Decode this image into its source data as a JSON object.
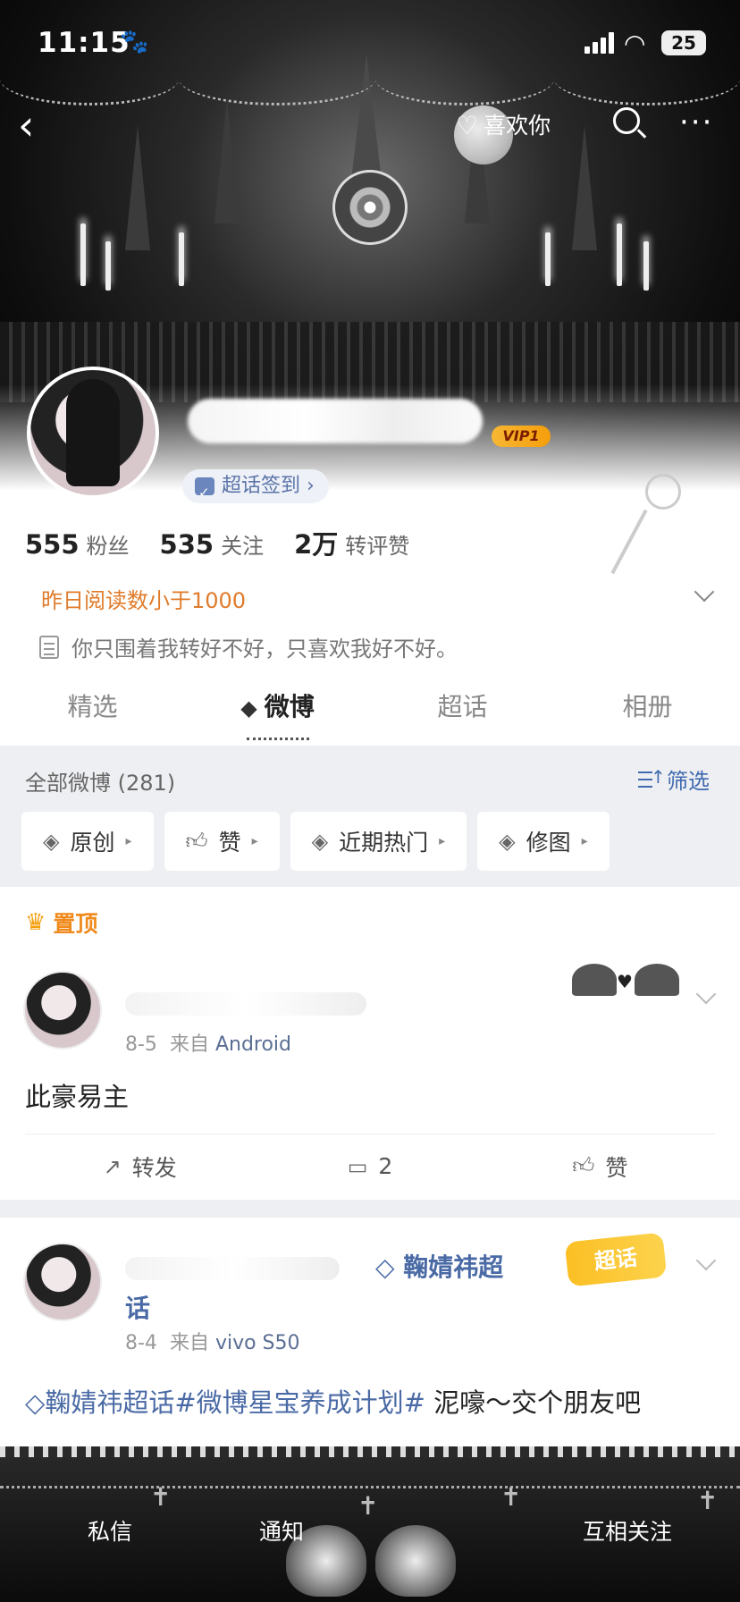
{
  "status_bar": {
    "time": "11:15",
    "battery": "25",
    "paw_icon": "paw-icon",
    "signal_icon": "signal-icon",
    "wifi_icon": "wifi-icon"
  },
  "nav": {
    "back_icon": "chevron-left-icon",
    "like_you": "喜欢你",
    "search_icon": "search-icon",
    "more_icon": "more-icon"
  },
  "profile": {
    "vip": "VIP1",
    "supertopic_checkin": "超话签到 ›",
    "stats": [
      {
        "value": "555",
        "label": "粉丝"
      },
      {
        "value": "535",
        "label": "关注"
      },
      {
        "value": "2万",
        "label": "转评赞"
      }
    ],
    "reads": "昨日阅读数小于1000",
    "bio": "你只围着我转好不好，只喜欢我好不好。"
  },
  "tabs": [
    {
      "label": "精选",
      "active": false
    },
    {
      "label": "微博",
      "active": true
    },
    {
      "label": "超话",
      "active": false
    },
    {
      "label": "相册",
      "active": false
    }
  ],
  "filter": {
    "all_weibo": "全部微博 (281)",
    "filter_label": "筛选",
    "chips": [
      "原创",
      "赞",
      "近期热门",
      "修图"
    ]
  },
  "posts": [
    {
      "pinned_label": "置顶",
      "date": "8-5",
      "from": "来自",
      "source": "Android",
      "text": "此豪易主",
      "actions": {
        "repost": "转发",
        "comments": "2",
        "like": "赞"
      }
    },
    {
      "supertopic_name": "鞠婧祎超",
      "supertopic_name_cont": "话",
      "sticker": "超话",
      "date": "8-4",
      "from": "来自",
      "source": "vivo S50",
      "tag": "鞠婧祎超话#微博星宝养成计划#",
      "text_rest": " 泥嚎～交个朋友吧"
    }
  ],
  "bottom_bar": {
    "items": [
      "私信",
      "通知",
      "互相关注"
    ]
  },
  "colors": {
    "orange": "#e07b2b",
    "link_blue": "#4a6aa5",
    "vip_gold": "#f59e0b"
  }
}
